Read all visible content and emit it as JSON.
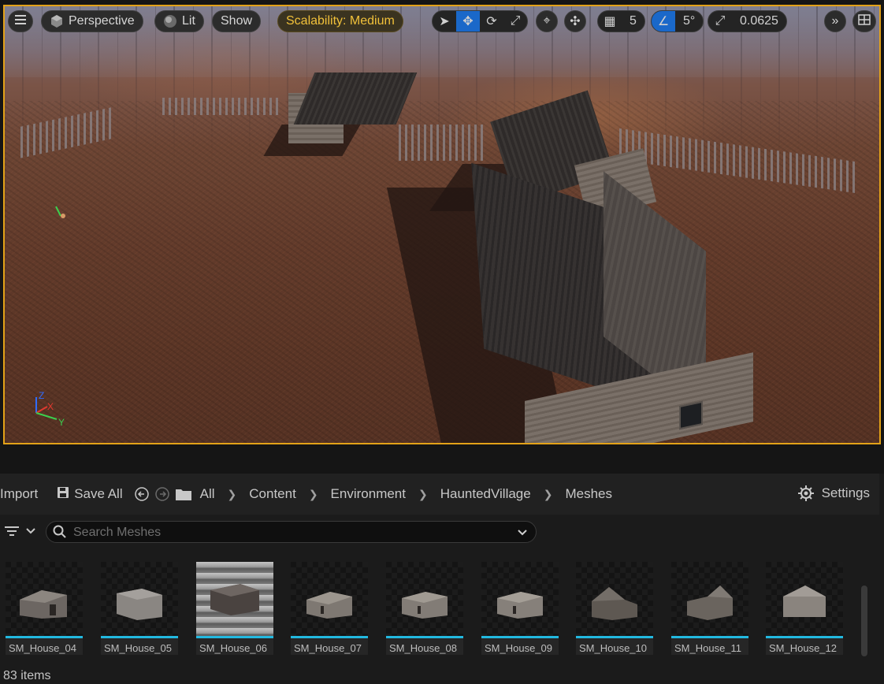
{
  "viewport": {
    "toolbar": {
      "view_mode": "Perspective",
      "lighting": "Lit",
      "show": "Show",
      "scalability": "Scalability: Medium",
      "grid_snap": "5",
      "rotation_snap": "5°",
      "scale_snap": "0.0625"
    },
    "axis_labels": {
      "x": "X",
      "y": "Y",
      "z": "Z"
    },
    "colors": {
      "border": "#e3a218",
      "active": "#1a68c9"
    }
  },
  "content_browser": {
    "toolbar": {
      "import": "Import",
      "save_all": "Save All",
      "settings": "Settings"
    },
    "breadcrumb": [
      "All",
      "Content",
      "Environment",
      "HauntedVillage",
      "Meshes"
    ],
    "search_placeholder": "Search Meshes",
    "assets": [
      {
        "name": "SM_House_04"
      },
      {
        "name": "SM_House_05"
      },
      {
        "name": "SM_House_06",
        "selected": true
      },
      {
        "name": "SM_House_07"
      },
      {
        "name": "SM_House_08"
      },
      {
        "name": "SM_House_09"
      },
      {
        "name": "SM_House_10"
      },
      {
        "name": "SM_House_11"
      },
      {
        "name": "SM_House_12"
      }
    ],
    "item_count": "83 items",
    "colors": {
      "asset_bar": "#22b9e0"
    }
  }
}
